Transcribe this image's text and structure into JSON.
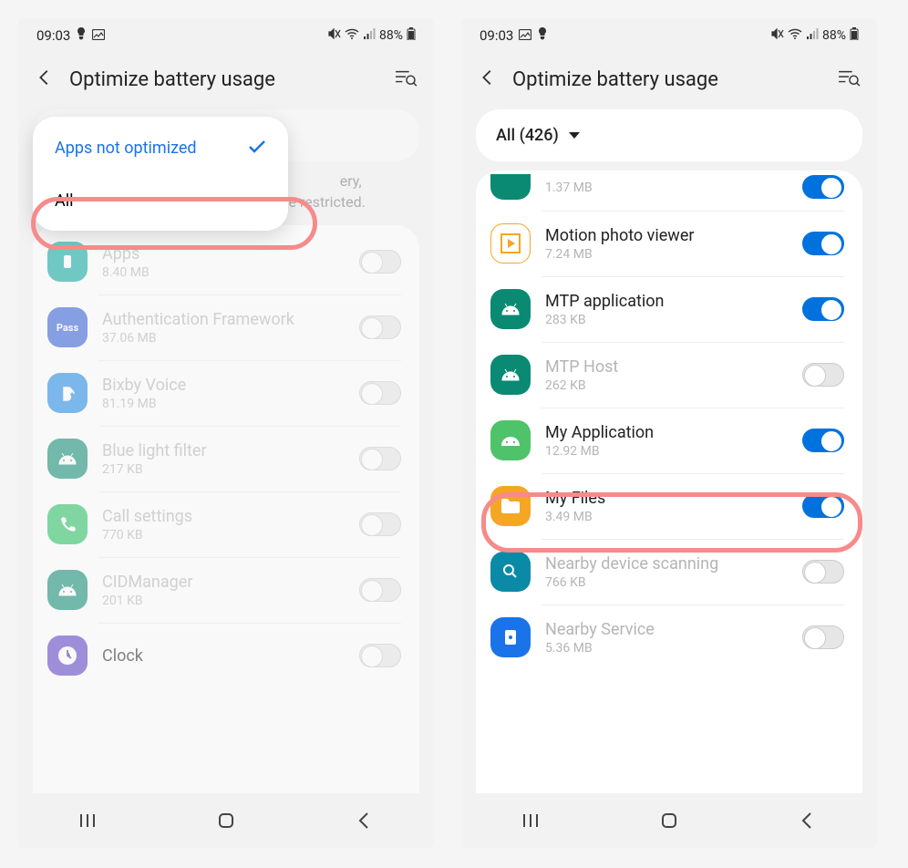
{
  "status": {
    "time": "09:03",
    "battery": "88%"
  },
  "header": {
    "title": "Optimize battery usage"
  },
  "left": {
    "dropdown": {
      "selected": "Apps not optimized",
      "other": "All"
    },
    "description_partial": "but some background functions will be restricted.",
    "description_tail": "ery,",
    "apps": [
      {
        "name": "Apps",
        "size": "8.40 MB",
        "icon_bg": "#06a6a0",
        "dim": true,
        "on": false,
        "glyph": "rect"
      },
      {
        "name": "Authentication Framework",
        "size": "37.06 MB",
        "icon_bg": "#2e5dd8",
        "dim": true,
        "on": false,
        "glyph": "pass"
      },
      {
        "name": "Bixby Voice",
        "size": "81.19 MB",
        "icon_bg": "#1a88e6",
        "dim": true,
        "on": false,
        "glyph": "b"
      },
      {
        "name": "Blue light filter",
        "size": "217 KB",
        "icon_bg": "#0a8a72",
        "dim": true,
        "on": false,
        "glyph": "android"
      },
      {
        "name": "Call settings",
        "size": "770 KB",
        "icon_bg": "#22c060",
        "dim": true,
        "on": false,
        "glyph": "phone"
      },
      {
        "name": "CIDManager",
        "size": "201 KB",
        "icon_bg": "#0a8a72",
        "dim": true,
        "on": false,
        "glyph": "android"
      },
      {
        "name": "Clock",
        "size": "",
        "icon_bg": "#5a3ec8",
        "dim": false,
        "on": false,
        "glyph": "clock",
        "partial": true
      }
    ]
  },
  "right": {
    "filter_label": "All (426)",
    "apps_partial": {
      "size": "1.37 MB",
      "icon_bg": "#0a8a72",
      "on": true
    },
    "apps": [
      {
        "name": "Motion photo viewer",
        "size": "7.24 MB",
        "icon_bg": "#ffffff",
        "border": true,
        "dim": false,
        "on": true,
        "glyph": "play"
      },
      {
        "name": "MTP application",
        "size": "283 KB",
        "icon_bg": "#0a8a72",
        "dim": false,
        "on": true,
        "glyph": "android"
      },
      {
        "name": "MTP Host",
        "size": "262 KB",
        "icon_bg": "#0a8a72",
        "dim": true,
        "on": false,
        "glyph": "android"
      },
      {
        "name": "My Application",
        "size": "12.92 MB",
        "icon_bg": "#4fc36a",
        "dim": false,
        "on": true,
        "glyph": "android-round"
      },
      {
        "name": "My Files",
        "size": "3.49 MB",
        "icon_bg": "#f5a623",
        "dim": false,
        "on": true,
        "glyph": "folder"
      },
      {
        "name": "Nearby device scanning",
        "size": "766 KB",
        "icon_bg": "#0a8aa6",
        "dim": true,
        "on": false,
        "glyph": "radar"
      },
      {
        "name": "Nearby Service",
        "size": "5.36 MB",
        "icon_bg": "#1a73e8",
        "dim": true,
        "on": false,
        "glyph": "nearby"
      }
    ]
  }
}
